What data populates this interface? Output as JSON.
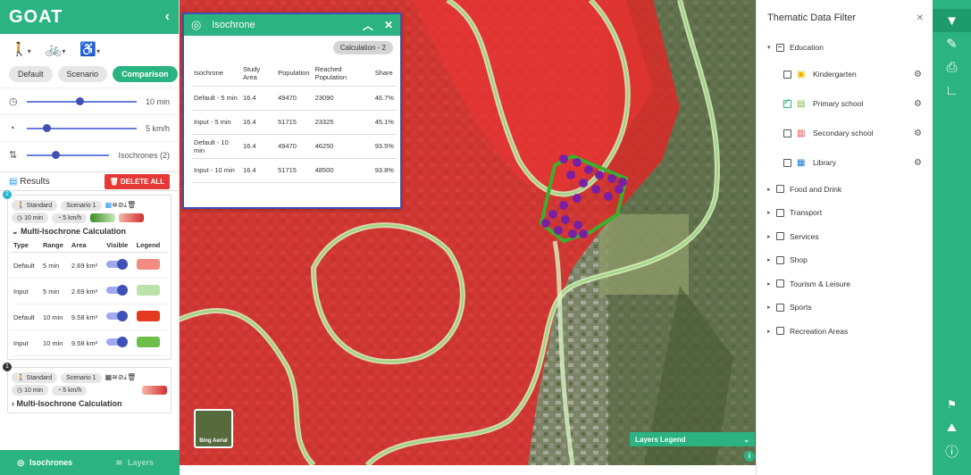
{
  "app": {
    "logo": "GOAT",
    "collapse": "‹"
  },
  "modes": [
    {
      "icon": "walk-icon",
      "glyph": "🚶"
    },
    {
      "icon": "bike-icon",
      "glyph": "🚲"
    },
    {
      "icon": "wheelchair-icon",
      "glyph": "♿"
    }
  ],
  "scenario_buttons": [
    "Default",
    "Scenario",
    "Comparison"
  ],
  "sliders": [
    {
      "icon": "clock-icon",
      "glyph": "◷",
      "value": "10 min",
      "fraction": 0.45
    },
    {
      "icon": "speed-icon",
      "glyph": "◔",
      "value": "5 km/h",
      "fraction": 0.15
    },
    {
      "icon": "isochrones-icon",
      "glyph": "⇅",
      "value": "Isochrones (2)",
      "fraction": 0.3
    }
  ],
  "results": {
    "title": "Results",
    "delete_label": "DELETE ALL"
  },
  "cards": [
    {
      "number": "2",
      "tags": [
        "Standard",
        "Scenario 1"
      ],
      "time": "10 min",
      "speed": "5 km/h",
      "calc_title": "Multi-Isochrone Calculation",
      "headers": [
        "Type",
        "Range",
        "Area",
        "Visible",
        "Legend"
      ],
      "rows": [
        {
          "type": "Default",
          "range": "5 min",
          "area": "2.69 km²",
          "color": "#f28b82"
        },
        {
          "type": "Input",
          "range": "5 min",
          "area": "2.69 km²",
          "color": "#b9e3a8"
        },
        {
          "type": "Default",
          "range": "10 min",
          "area": "9.58 km²",
          "color": "#e53920"
        },
        {
          "type": "Input",
          "range": "10 min",
          "area": "9.58 km²",
          "color": "#6cc04a"
        }
      ]
    },
    {
      "number": "1",
      "tags": [
        "Standard",
        "Scenario 1"
      ],
      "time": "10 min",
      "speed": "5 km/h",
      "calc_title": "Multi-Isochrone Calculation"
    }
  ],
  "bottom_tabs": [
    "Isochrones",
    "Layers"
  ],
  "popup": {
    "title": "Isochrone",
    "calc_badge": "Calculation - 2",
    "headers": [
      "Isochrone",
      "Study Area",
      "Population",
      "Reached Population",
      "Share"
    ],
    "rows": [
      [
        "Default - 5 min",
        "16.4",
        "49470",
        "23090",
        "46.7%"
      ],
      [
        "Input - 5 min",
        "16.4",
        "51715",
        "23325",
        "45.1%"
      ],
      [
        "Default - 10 min",
        "16.4",
        "49470",
        "46250",
        "93.5%"
      ],
      [
        "Input - 10 min",
        "16.4",
        "51715",
        "48500",
        "93.8%"
      ]
    ]
  },
  "map": {
    "basemap_label": "Bing Aerial",
    "legend_label": "Layers Legend",
    "info": "i"
  },
  "filter": {
    "title": "Thematic Data Filter",
    "close": "✕",
    "education": {
      "label": "Education",
      "items": [
        {
          "label": "Kindergarten",
          "checked": false,
          "icon": "kindergarten-icon"
        },
        {
          "label": "Primary school",
          "checked": true,
          "icon": "primary-school-icon"
        },
        {
          "label": "Secondary school",
          "checked": false,
          "icon": "secondary-school-icon"
        },
        {
          "label": "Library",
          "checked": false,
          "icon": "library-icon"
        }
      ]
    },
    "categories": [
      "Food and Drink",
      "Transport",
      "Services",
      "Shop",
      "Tourism & Leisure",
      "Sports",
      "Recreation Areas"
    ]
  },
  "toolbar": [
    {
      "name": "filter-icon",
      "glyph": "▼"
    },
    {
      "name": "edit-icon",
      "glyph": "✎"
    },
    {
      "name": "print-icon",
      "glyph": "⎙"
    },
    {
      "name": "measure-icon",
      "glyph": "📐"
    }
  ],
  "toolbar_bottom": [
    {
      "name": "language-flag-icon",
      "glyph": "🇬🇧"
    },
    {
      "name": "map-icon",
      "glyph": "🗺"
    },
    {
      "name": "info-icon",
      "glyph": "ⓘ"
    }
  ]
}
